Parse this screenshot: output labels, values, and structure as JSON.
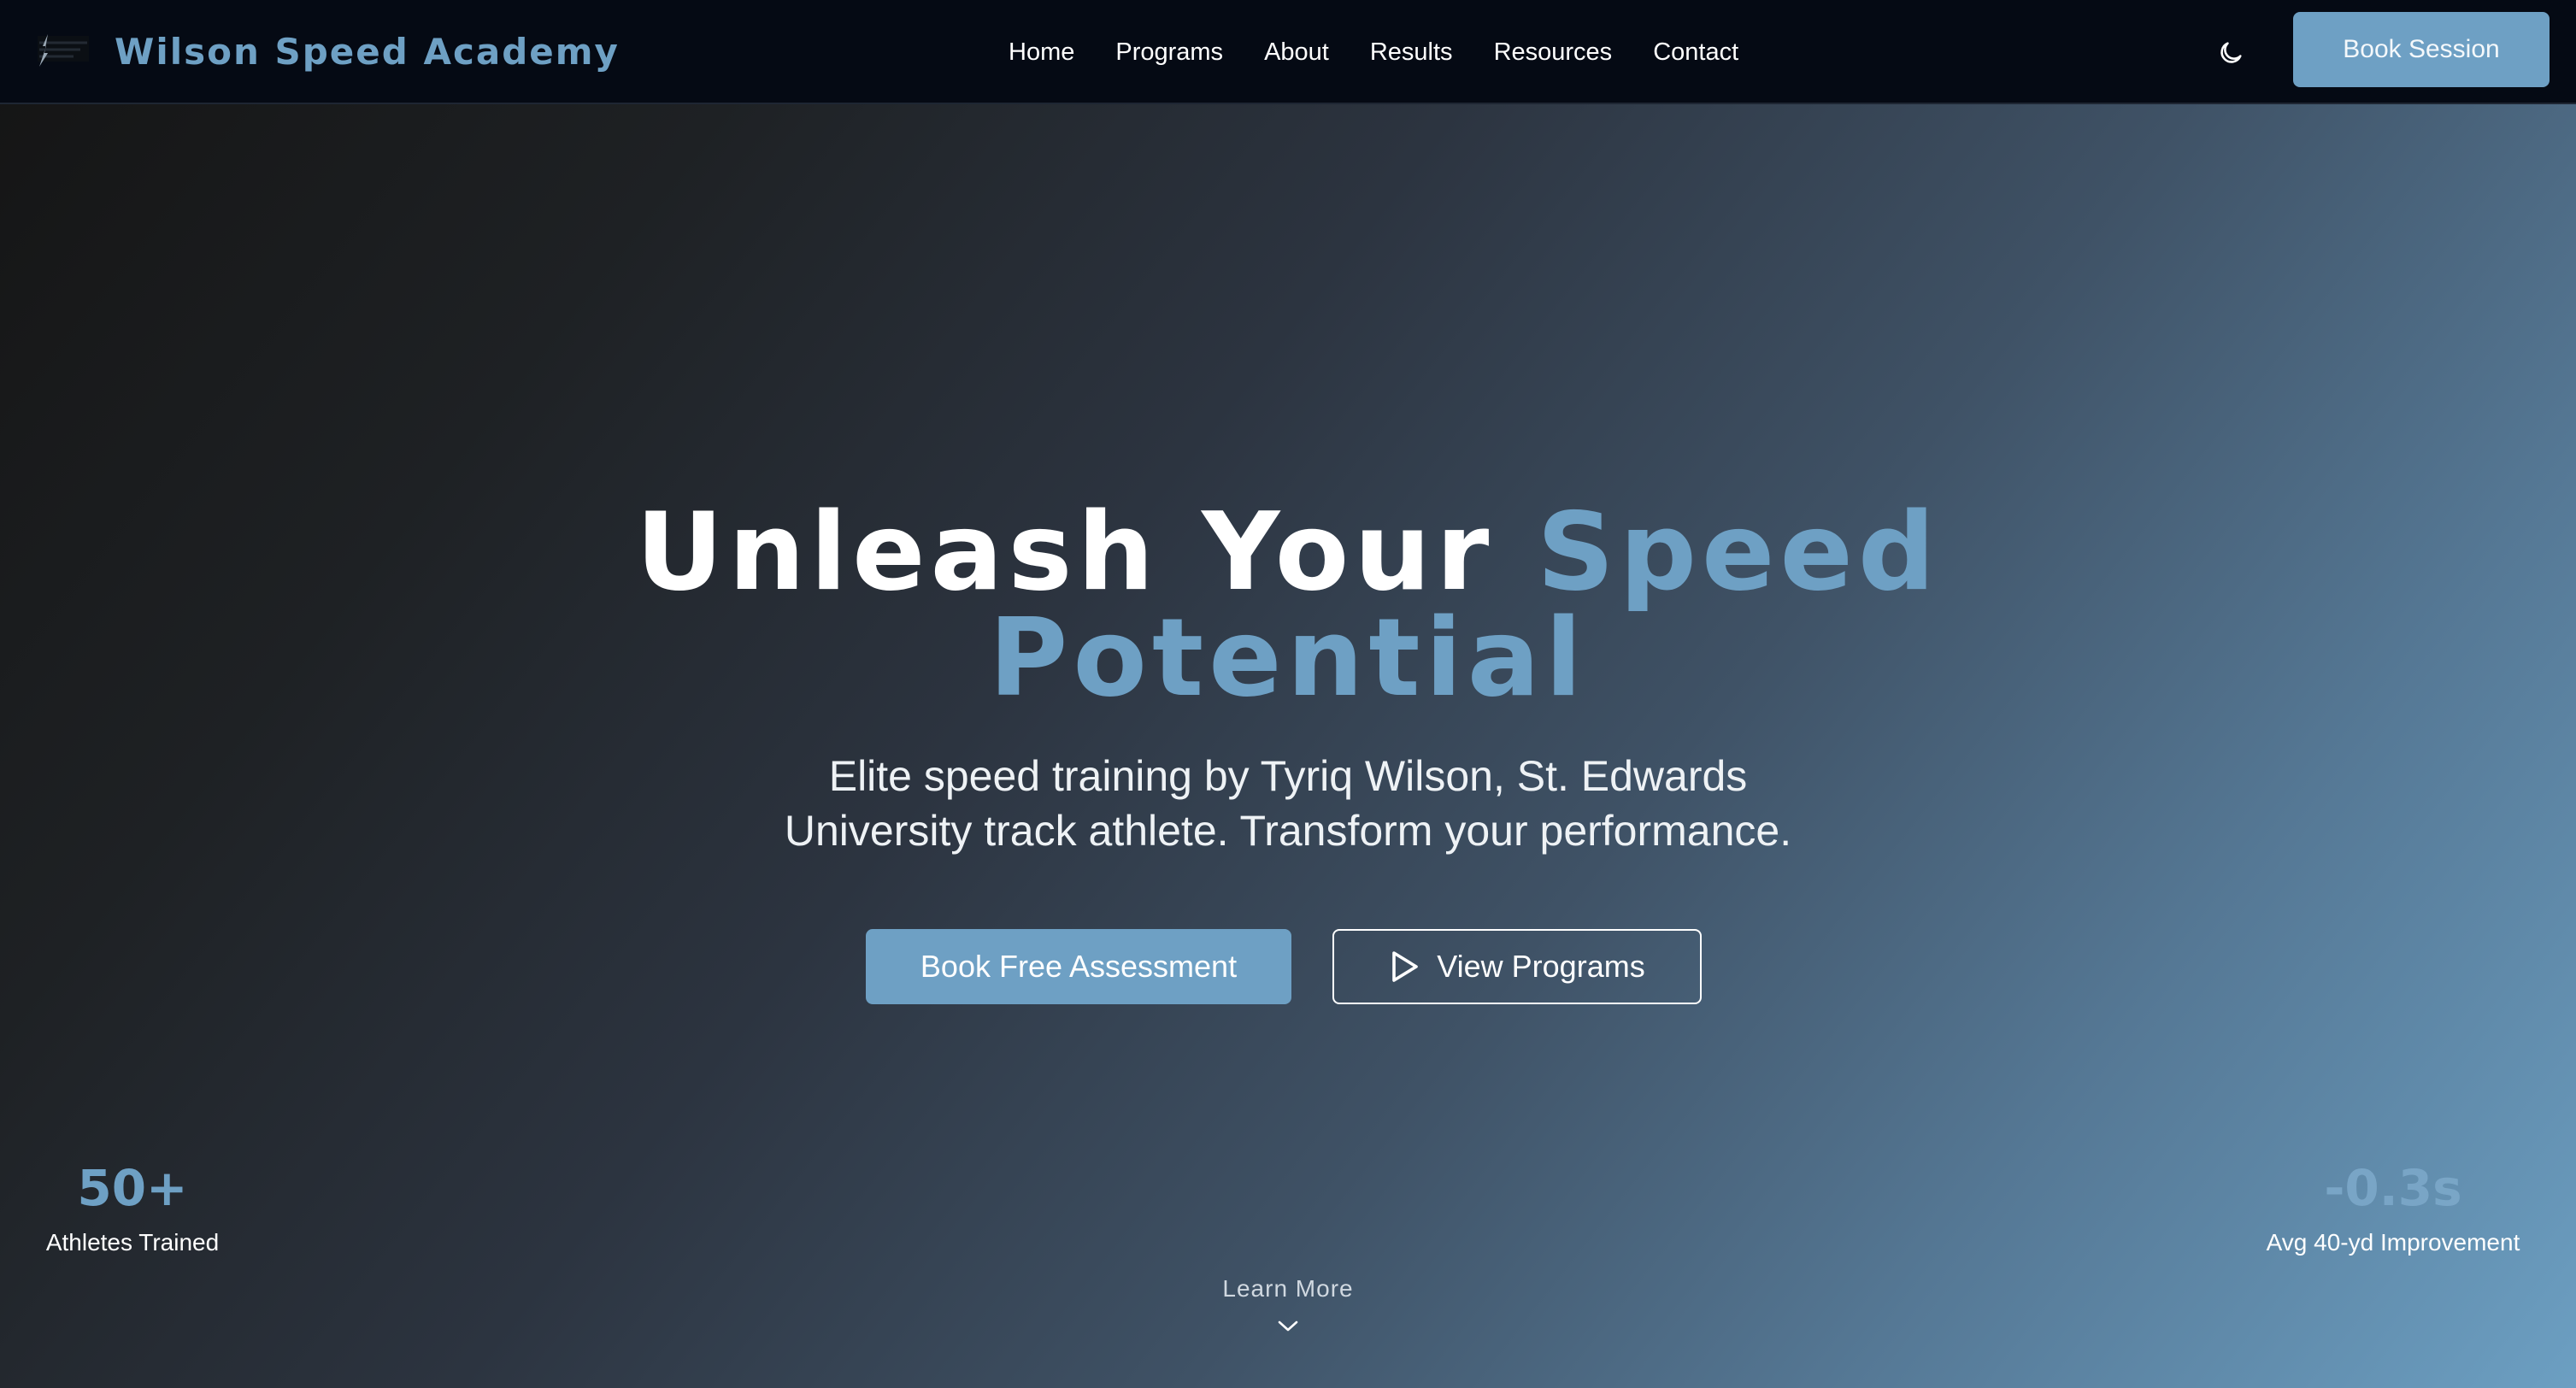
{
  "nav": {
    "brand": "Wilson Speed Academy",
    "links": [
      "Home",
      "Programs",
      "About",
      "Results",
      "Resources",
      "Contact"
    ],
    "cta": "Book Session",
    "logo_icon": "lightning-bolt-logo-icon",
    "theme_icon": "moon-icon"
  },
  "hero": {
    "title_main": "Unleash Your ",
    "title_accent_1": "Speed",
    "title_accent_2": "Potential",
    "subtitle": "Elite speed training by Tyriq Wilson, St. Edwards University track athlete. Transform your performance.",
    "primary_cta": "Book Free Assessment",
    "secondary_cta": "View Programs",
    "secondary_icon": "play-icon"
  },
  "stats": [
    {
      "value": "50+",
      "label": "Athletes Trained"
    },
    {
      "value": "-0.3s",
      "label": "Avg 40-yd Improvement"
    }
  ],
  "scroll_hint": {
    "label": "Learn More",
    "icon": "chevron-down-icon"
  },
  "colors": {
    "accent": "#6ea0c4",
    "nav_bg": "#050a14",
    "text": "#ffffff"
  }
}
